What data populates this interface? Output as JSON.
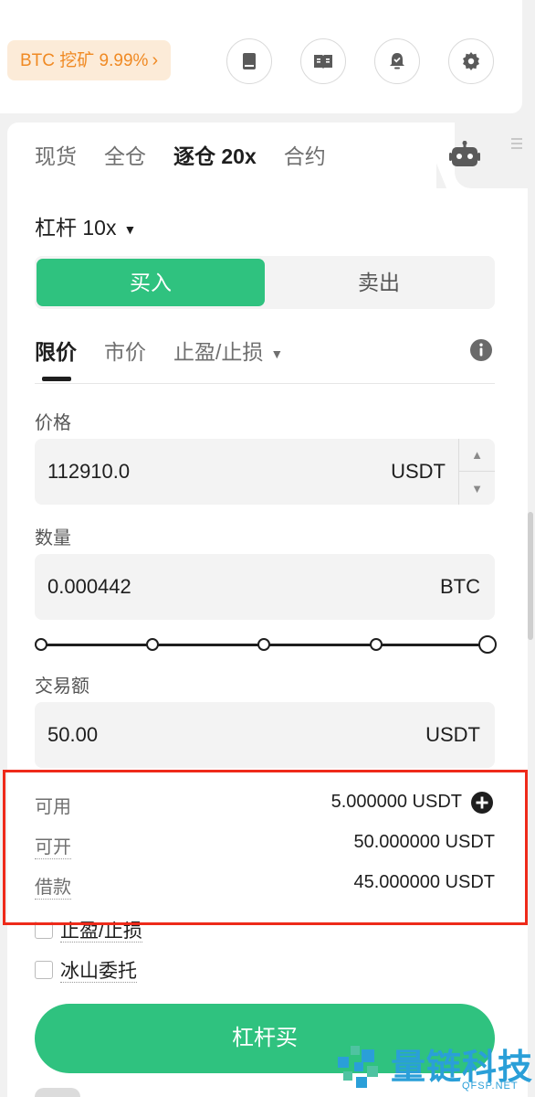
{
  "header": {
    "promo": {
      "label": "BTC 挖矿 9.99%",
      "chevron": "›"
    },
    "icons": [
      "book-icon",
      "guide-icon",
      "alert-bell-icon",
      "settings-gear-icon"
    ]
  },
  "trade_types": [
    {
      "label": "现货"
    },
    {
      "label": "全仓"
    },
    {
      "label": "逐仓 20x",
      "active": true
    },
    {
      "label": "合约"
    }
  ],
  "leverage": {
    "label": "杠杆",
    "value": "10x"
  },
  "side": {
    "buy_label": "买入",
    "sell_label": "卖出",
    "selected": "buy"
  },
  "order_tabs": {
    "limit": "限价",
    "market": "市价",
    "tpsl": "止盈/止损"
  },
  "price": {
    "label": "价格",
    "value": "112910.0",
    "unit": "USDT"
  },
  "quantity": {
    "label": "数量",
    "value": "0.000442",
    "unit": "BTC"
  },
  "slider": {
    "percent": 100
  },
  "amount": {
    "label": "交易额",
    "value": "50.00",
    "unit": "USDT"
  },
  "balances": {
    "available_label": "可用",
    "available_value": "5.000000 USDT",
    "openable_label": "可开",
    "openable_value": "50.000000 USDT",
    "borrow_label": "借款",
    "borrow_value": "45.000000 USDT"
  },
  "options": {
    "tpsl_label": "止盈/止损",
    "iceberg_label": "冰山委托"
  },
  "submit_label": "杠杆买",
  "watermark": {
    "title": "量链科技",
    "subtitle": "QFSP.NET"
  },
  "colors": {
    "buy": "#2fc27f",
    "promo_text": "#f08a24",
    "highlight": "#ee2a1a",
    "watermark": "#2a9fd8"
  }
}
